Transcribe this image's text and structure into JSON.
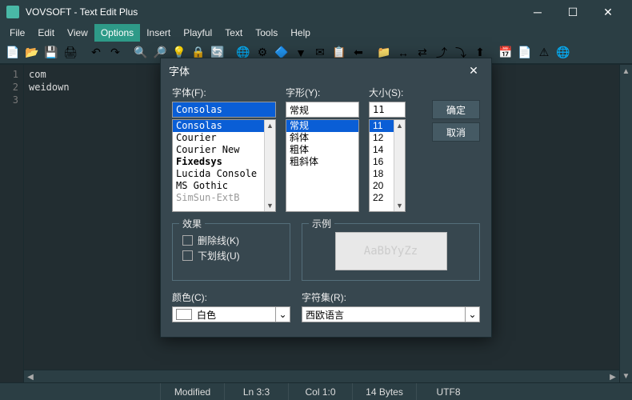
{
  "title": "VOVSOFT - Text Edit Plus",
  "menus": [
    "File",
    "Edit",
    "View",
    "Options",
    "Insert",
    "Playful",
    "Text",
    "Tools",
    "Help"
  ],
  "active_menu_index": 3,
  "toolbar_icons": [
    "📄",
    "📂",
    "💾",
    "🖨",
    "|",
    "↶",
    "↷",
    "|",
    "🔍",
    "🔎",
    "💡",
    "🔒",
    "🔄",
    "|",
    "🌐",
    "⚙",
    "🔷",
    "▼",
    "✉",
    "📋",
    "⬅",
    "|",
    "📁",
    "↔",
    "⇄",
    "⤴",
    "⤵",
    "⬆",
    "|",
    "📅",
    "📄",
    "⚠",
    "🌐"
  ],
  "lines": [
    {
      "n": "1",
      "text": "com"
    },
    {
      "n": "2",
      "text": "weidown"
    },
    {
      "n": "3",
      "text": ""
    }
  ],
  "status": {
    "modified": "Modified",
    "ln": "Ln 3:3",
    "col": "Col 1:0",
    "size": "14 Bytes",
    "enc": "UTF8"
  },
  "dialog": {
    "title": "字体",
    "labels": {
      "font": "字体(F):",
      "style": "字形(Y):",
      "size": "大小(S):",
      "effects": "效果",
      "strike": "删除线(K)",
      "underline": "下划线(U)",
      "color": "颜色(C):",
      "sample": "示例",
      "script": "字符集(R):"
    },
    "buttons": {
      "ok": "确定",
      "cancel": "取消"
    },
    "font_value": "Consolas",
    "font_list": [
      "Consolas",
      "Courier",
      "Courier New",
      "Fixedsys",
      "Lucida Console",
      "MS Gothic",
      "SimSun-ExtB"
    ],
    "style_value": "常规",
    "style_list": [
      "常规",
      "斜体",
      "粗体",
      "粗斜体"
    ],
    "size_value": "11",
    "size_list": [
      "11",
      "12",
      "14",
      "16",
      "18",
      "20",
      "22"
    ],
    "color_value": "白色",
    "sample_text": "AaBbYyZz",
    "script_value": "西欧语言"
  }
}
